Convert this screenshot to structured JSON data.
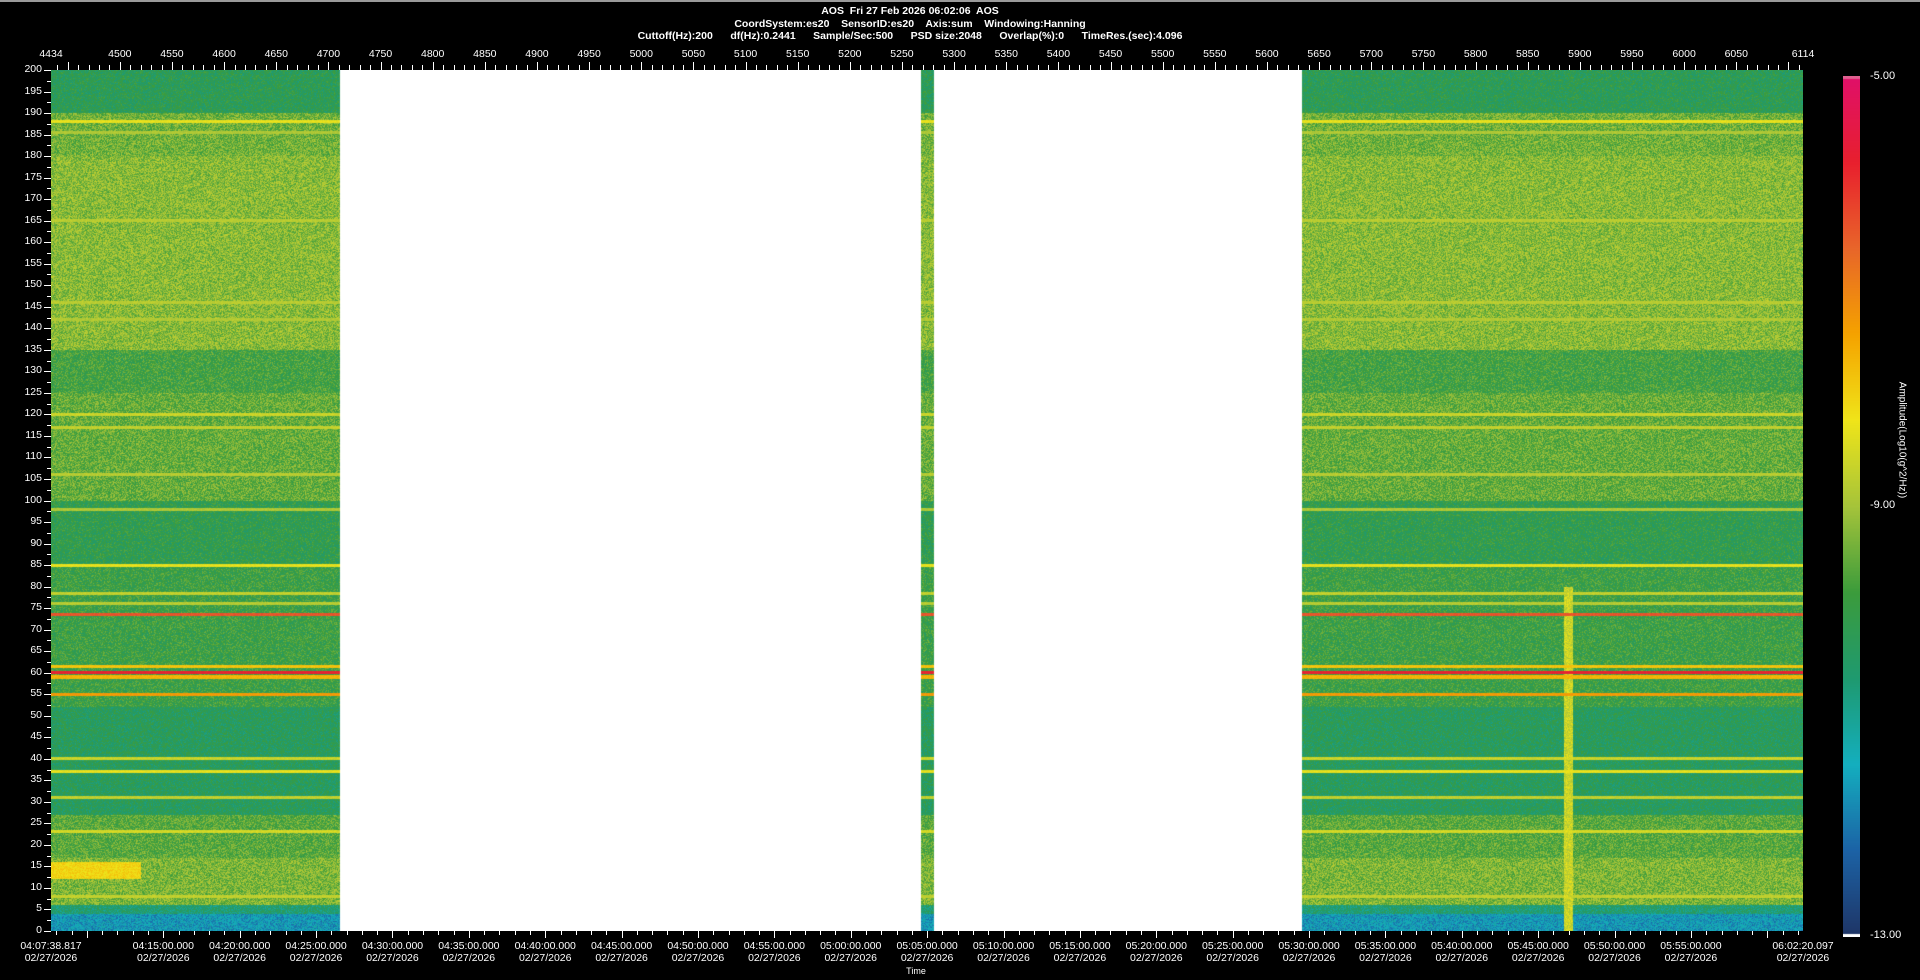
{
  "header": {
    "line1": "AOS  Fri 27 Feb 2026 06:02:06  AOS",
    "line2": "CoordSystem:es20    SensorID:es20    Axis:sum    Windowing:Hanning",
    "line3": "Cuttoff(Hz):200      df(Hz):0.2441      Sample/Sec:500      PSD size:2048      Overlap(%):0      TimeRes.(sec):4.096"
  },
  "chart_data": {
    "type": "heatmap",
    "title": "AOS  Fri 27 Feb 2026 06:02:06  AOS",
    "xlabel": "Time",
    "ylabel": "",
    "top_axis": {
      "range": [
        4434,
        6114
      ],
      "ticks": [
        "4434",
        "4500",
        "4550",
        "4600",
        "4650",
        "4700",
        "4750",
        "4800",
        "4850",
        "4900",
        "4950",
        "5000",
        "5050",
        "5100",
        "5150",
        "5200",
        "5250",
        "5300",
        "5350",
        "5400",
        "5450",
        "5500",
        "5550",
        "5600",
        "5650",
        "5700",
        "5750",
        "5800",
        "5850",
        "5900",
        "5950",
        "6000",
        "6050",
        "6114"
      ]
    },
    "y_axis": {
      "range": [
        0,
        200
      ],
      "step": 5
    },
    "time_axis": {
      "start": "04:07:38.817",
      "end": "06:02:20.097",
      "date": "02/27/2026",
      "ticks": [
        "04:07:38.817",
        "04:15:00.000",
        "04:20:00.000",
        "04:25:00.000",
        "04:30:00.000",
        "04:35:00.000",
        "04:40:00.000",
        "04:45:00.000",
        "04:50:00.000",
        "04:55:00.000",
        "05:00:00.000",
        "05:05:00.000",
        "05:10:00.000",
        "05:15:00.000",
        "05:20:00.000",
        "05:25:00.000",
        "05:30:00.000",
        "05:35:00.000",
        "05:40:00.000",
        "05:45:00.000",
        "05:50:00.000",
        "05:55:00.000",
        "06:02:20.097"
      ]
    },
    "data_segments": [
      [
        4434,
        4711
      ],
      [
        5268,
        5281
      ],
      [
        5634,
        6114
      ]
    ],
    "colorbar": {
      "label": "Amplitude(Log10(g^2/Hz))",
      "range": [
        -13,
        -5
      ],
      "tick_labels": [
        "-5.00",
        "-9.00",
        "-13.00"
      ],
      "colors": [
        "#1f3566",
        "#1c63a6",
        "#14afbf",
        "#1f9a70",
        "#3c9c3c",
        "#a6c43a",
        "#f0e51a",
        "#f5a300",
        "#e8662a",
        "#e8202e",
        "#e0106a"
      ]
    },
    "line_features_hz": [
      {
        "hz": 188,
        "level": -8.3
      },
      {
        "hz": 185.5,
        "level": -8.9
      },
      {
        "hz": 165,
        "level": -8.8
      },
      {
        "hz": 146,
        "level": -8.8
      },
      {
        "hz": 142,
        "level": -8.9
      },
      {
        "hz": 120,
        "level": -8.6
      },
      {
        "hz": 117,
        "level": -8.7
      },
      {
        "hz": 106,
        "level": -8.8
      },
      {
        "hz": 98,
        "level": -8.9
      },
      {
        "hz": 85,
        "level": -8.3
      },
      {
        "hz": 78.5,
        "level": -8.7
      },
      {
        "hz": 76,
        "level": -8.8
      },
      {
        "hz": 73.5,
        "level": -6.4
      },
      {
        "hz": 61.5,
        "level": -7.8
      },
      {
        "hz": 60,
        "level": -5.8
      },
      {
        "hz": 59,
        "level": -7.6
      },
      {
        "hz": 55,
        "level": -7.3
      },
      {
        "hz": 40,
        "level": -8.6
      },
      {
        "hz": 37,
        "level": -8.3
      },
      {
        "hz": 31,
        "level": -8.7
      },
      {
        "hz": 23,
        "level": -8.5
      },
      {
        "hz": 8,
        "level": -8.7
      }
    ]
  }
}
